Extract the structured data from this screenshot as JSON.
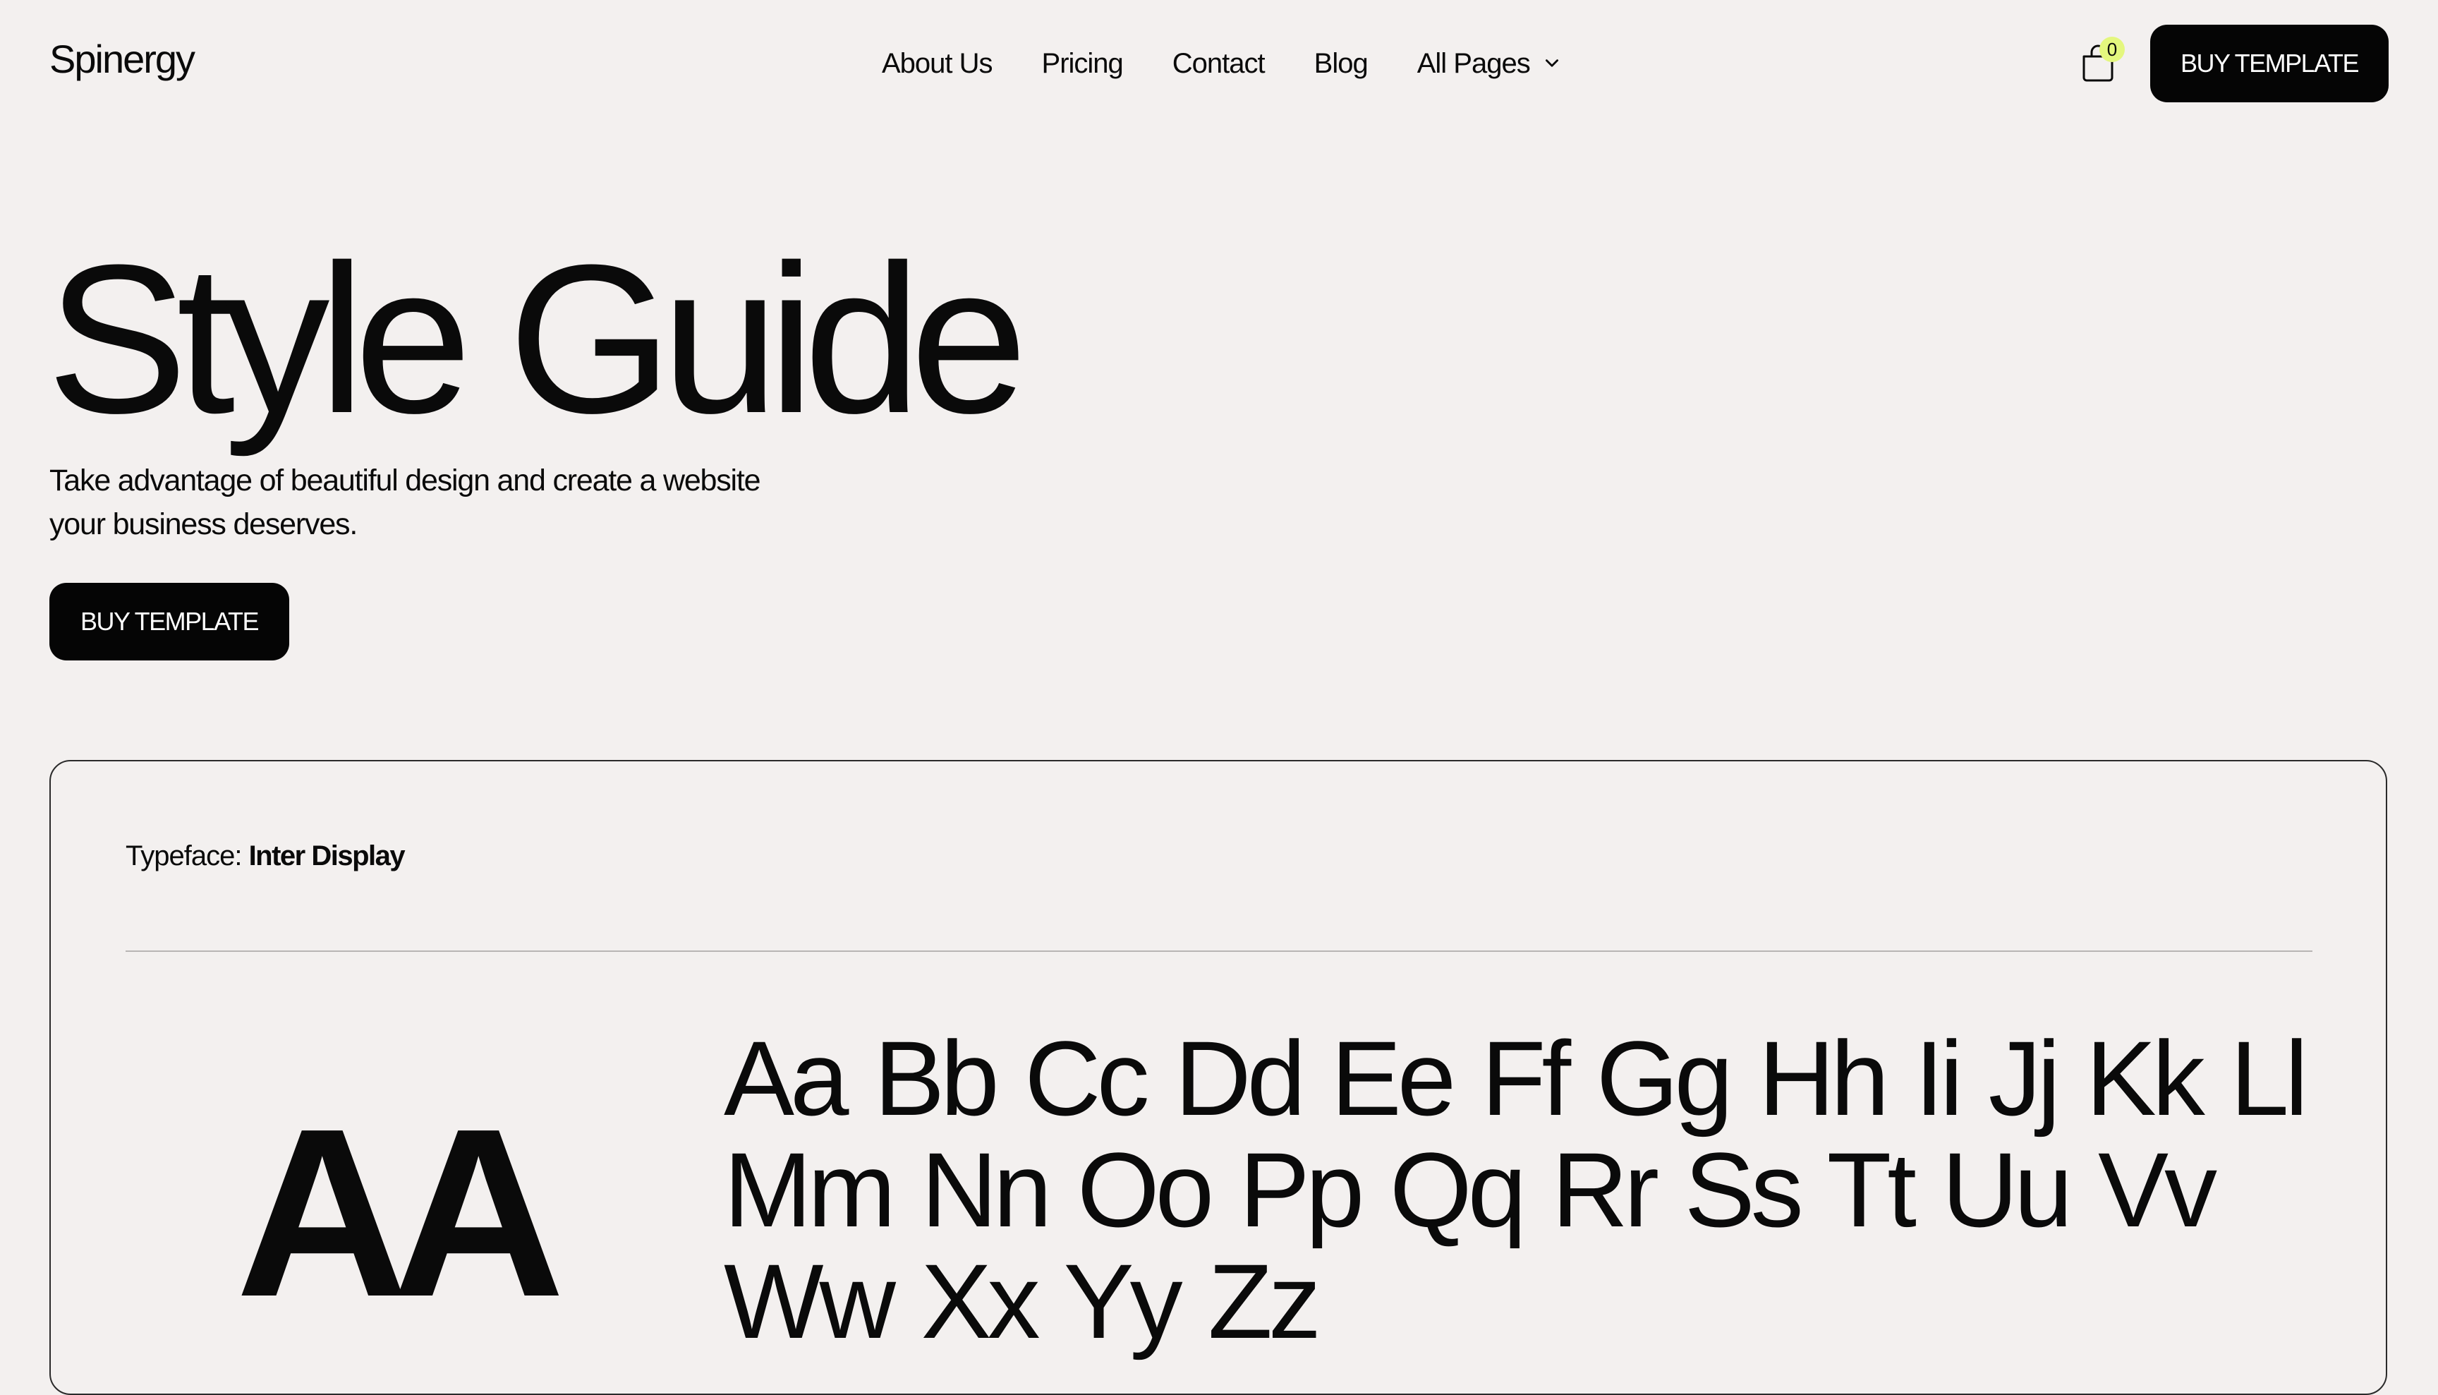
{
  "nav": {
    "logo": "Spinergy",
    "links": [
      "About Us",
      "Pricing",
      "Contact",
      "Blog"
    ],
    "dropdown_label": "All Pages",
    "cart_count": "0",
    "buy_label": "BUY TEMPLATE"
  },
  "hero": {
    "title": "Style Guide",
    "subtitle_line1": "Take advantage of beautiful design and create a website",
    "subtitle_line2": "your business deserves.",
    "button_label": "BUY TEMPLATE"
  },
  "typeface": {
    "prefix": "Typeface: ",
    "name": "Inter Display",
    "sample_big": "AA",
    "alphabet": "Aa Bb Cc Dd Ee Ff Gg Hh Ii Jj Kk Ll Mm Nn Oo Pp Qq Rr Ss Tt Uu Vv Ww Xx Yy Zz"
  },
  "colors": {
    "background": "#f3f0ef",
    "text": "#0a0a0a",
    "button": "#050505",
    "badge": "#e4f77e"
  },
  "icons": {
    "cart": "shopping-bag-icon",
    "dropdown": "chevron-down-icon"
  }
}
